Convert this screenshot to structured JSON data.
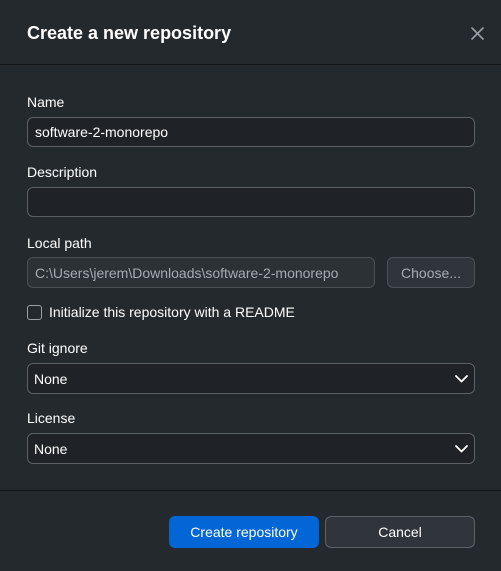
{
  "dialog": {
    "title": "Create a new repository"
  },
  "fields": {
    "name_label": "Name",
    "name_value": "software-2-monorepo",
    "description_label": "Description",
    "description_value": "",
    "local_path_label": "Local path",
    "local_path_value": "C:\\Users\\jerem\\Downloads\\software-2-monorepo",
    "choose_label": "Choose...",
    "readme_label": "Initialize this repository with a README",
    "readme_checked": false,
    "gitignore_label": "Git ignore",
    "gitignore_value": "None",
    "license_label": "License",
    "license_value": "None"
  },
  "footer": {
    "create_label": "Create repository",
    "cancel_label": "Cancel"
  },
  "colors": {
    "background": "#24292e",
    "primary": "#0366d6",
    "input_bg": "#1f2226"
  }
}
